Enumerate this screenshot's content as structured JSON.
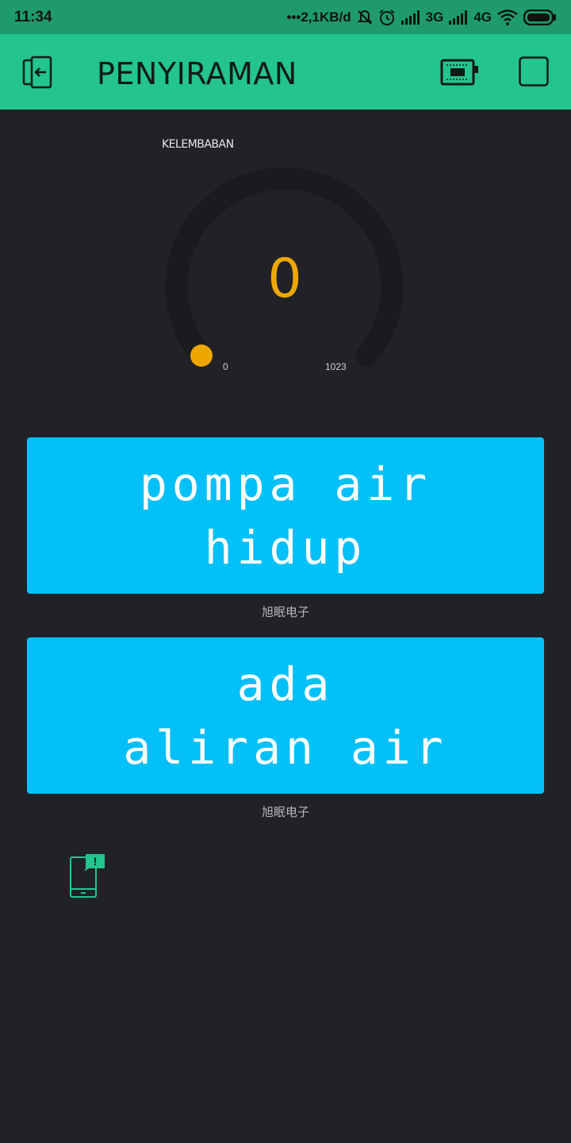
{
  "status_bar": {
    "time": "11:34",
    "network_speed": "•••2,1KB/d",
    "net1": "3G",
    "net2": "4G"
  },
  "header": {
    "title": "PENYIRAMAN",
    "back_icon": "exit-icon",
    "device_icon": "device-chip-icon",
    "square_icon": "square-icon"
  },
  "gauge": {
    "label": "KELEMBABAN",
    "value": "0",
    "min": "0",
    "max": "1023",
    "level": 0,
    "accent": "#eda700"
  },
  "lcd1": {
    "line1": "pompa air",
    "line2": "hidup",
    "caption": "旭眠电子"
  },
  "lcd2": {
    "line1": "ada",
    "line2": "aliran air",
    "caption": "旭眠电子"
  },
  "colors": {
    "header_bg": "#23c48e",
    "status_bg": "#1f9a6b",
    "lcd_bg": "#04c0f8",
    "page_bg": "#212227"
  }
}
